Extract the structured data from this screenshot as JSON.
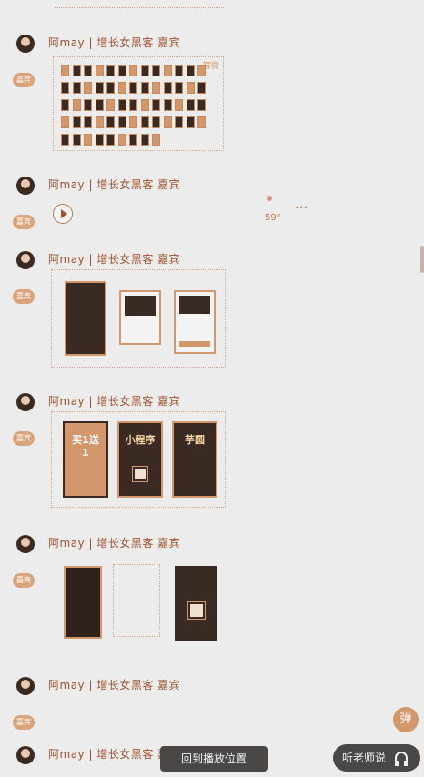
{
  "author_name": "阿may | 增长女黑客 嘉宾",
  "badge_label": "嘉宾",
  "audio": {
    "duration": "59\""
  },
  "controls": {
    "back_to_play": "回到播放位置",
    "listen_teacher": "听老师说",
    "float_label": "弹"
  },
  "grid_mark": "官微",
  "posters": [
    {
      "headline": "买1送1"
    },
    {
      "headline": "小程序"
    },
    {
      "headline": "芋圆"
    }
  ],
  "colors": {
    "accent": "#d2976a",
    "name": "#a0522d",
    "dark": "#4a4846"
  }
}
